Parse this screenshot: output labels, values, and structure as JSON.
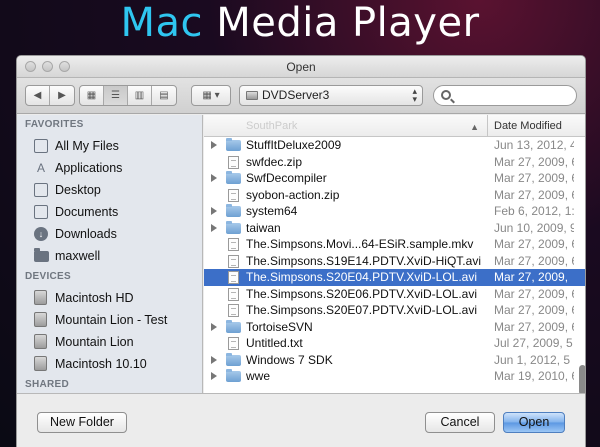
{
  "brand": {
    "part1": "Mac",
    "part2": " Media Player"
  },
  "dialog": {
    "title": "Open"
  },
  "toolbar": {
    "back_icon": "chevron-left-icon",
    "forward_icon": "chevron-right-icon",
    "view_modes": [
      "icon-view",
      "list-view",
      "column-view",
      "coverflow-view"
    ],
    "active_view": "list-view",
    "location": "DVDServer3",
    "search_placeholder": ""
  },
  "sidebar": {
    "sections": [
      {
        "title": "FAVORITES",
        "items": [
          {
            "label": "All My Files",
            "icon": "all-files-icon"
          },
          {
            "label": "Applications",
            "icon": "applications-icon"
          },
          {
            "label": "Desktop",
            "icon": "desktop-icon"
          },
          {
            "label": "Documents",
            "icon": "documents-icon"
          },
          {
            "label": "Downloads",
            "icon": "downloads-icon"
          },
          {
            "label": "maxwell",
            "icon": "folder-icon"
          }
        ]
      },
      {
        "title": "DEVICES",
        "items": [
          {
            "label": "Macintosh HD",
            "icon": "disk-icon"
          },
          {
            "label": "Mountain Lion - Test",
            "icon": "disk-icon"
          },
          {
            "label": "Mountain Lion",
            "icon": "disk-icon"
          },
          {
            "label": "Macintosh 10.10",
            "icon": "disk-icon"
          }
        ]
      },
      {
        "title": "SHARED",
        "items": []
      }
    ]
  },
  "filelist": {
    "columns": {
      "name": "SouthPark",
      "date": "Date Modified"
    },
    "rows": [
      {
        "name": "StuffItDeluxe2009",
        "date": "Jun 13, 2012, 4",
        "type": "folder",
        "selected": false
      },
      {
        "name": "swfdec.zip",
        "date": "Mar 27, 2009, 6",
        "type": "file",
        "selected": false
      },
      {
        "name": "SwfDecompiler",
        "date": "Mar 27, 2009, 6",
        "type": "folder",
        "selected": false
      },
      {
        "name": "syobon-action.zip",
        "date": "Mar 27, 2009, 6",
        "type": "file",
        "selected": false
      },
      {
        "name": "system64",
        "date": "Feb 6, 2012, 1:5",
        "type": "folder",
        "selected": false
      },
      {
        "name": "taiwan",
        "date": "Jun 10, 2009, 9",
        "type": "folder",
        "selected": false
      },
      {
        "name": "The.Simpsons.Movi...64-ESiR.sample.mkv",
        "date": "Mar 27, 2009, 6",
        "type": "file",
        "selected": false
      },
      {
        "name": "The.Simpsons.S19E14.PDTV.XviD-HiQT.avi",
        "date": "Mar 27, 2009, 6",
        "type": "file",
        "selected": false
      },
      {
        "name": "The.Simpsons.S20E04.PDTV.XviD-LOL.avi",
        "date": "Mar 27, 2009,",
        "type": "file",
        "selected": true
      },
      {
        "name": "The.Simpsons.S20E06.PDTV.XviD-LOL.avi",
        "date": "Mar 27, 2009, 6",
        "type": "file",
        "selected": false
      },
      {
        "name": "The.Simpsons.S20E07.PDTV.XviD-LOL.avi",
        "date": "Mar 27, 2009, 6",
        "type": "file",
        "selected": false
      },
      {
        "name": "TortoiseSVN",
        "date": "Mar 27, 2009, 6",
        "type": "folder",
        "selected": false
      },
      {
        "name": "Untitled.txt",
        "date": "Jul 27, 2009, 5",
        "type": "file",
        "selected": false
      },
      {
        "name": "Windows 7 SDK",
        "date": "Jun 1, 2012, 5",
        "type": "folder",
        "selected": false
      },
      {
        "name": "wwe",
        "date": "Mar 19, 2010, 6",
        "type": "folder",
        "selected": false
      }
    ]
  },
  "buttons": {
    "new_folder": "New Folder",
    "cancel": "Cancel",
    "open": "Open"
  },
  "colors": {
    "brand_accent": "#2fc6f0",
    "selection": "#3c6fc8",
    "folder": "#8cb6e0"
  }
}
